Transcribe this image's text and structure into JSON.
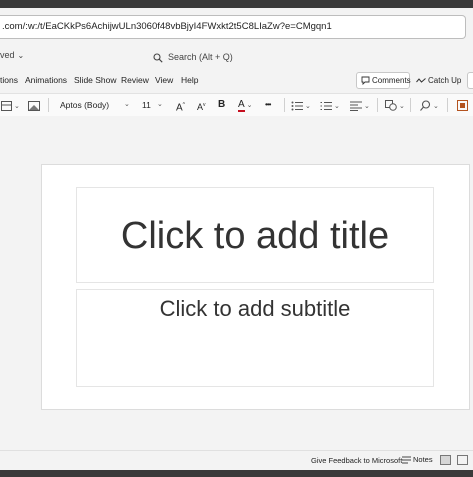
{
  "browser": {
    "url": ".com/:w:/t/EaCKkPs6AchijwULn3060f48vbBjyI4FWxkt2t5C8LIaZw?e=CMgqn1"
  },
  "titlebar": {
    "saved_label": "ved",
    "search_placeholder": "Search (Alt + Q)"
  },
  "menu": {
    "items": [
      "tions",
      "Animations",
      "Slide Show",
      "Review",
      "View",
      "Help"
    ],
    "comments_label": "Comments",
    "catchup_label": "Catch Up"
  },
  "ribbon": {
    "font_name": "Aptos (Body)",
    "font_size": "11",
    "more_label": "•••",
    "bold_label": "B",
    "font_color_label": "A",
    "font_color_accent": "#c50f1f",
    "grow_label": "A",
    "shrink_label": "A"
  },
  "slide": {
    "title_placeholder": "Click to add title",
    "subtitle_placeholder": "Click to add subtitle"
  },
  "statusbar": {
    "feedback_label": "Give Feedback to Microsoft",
    "notes_label": "Notes"
  }
}
